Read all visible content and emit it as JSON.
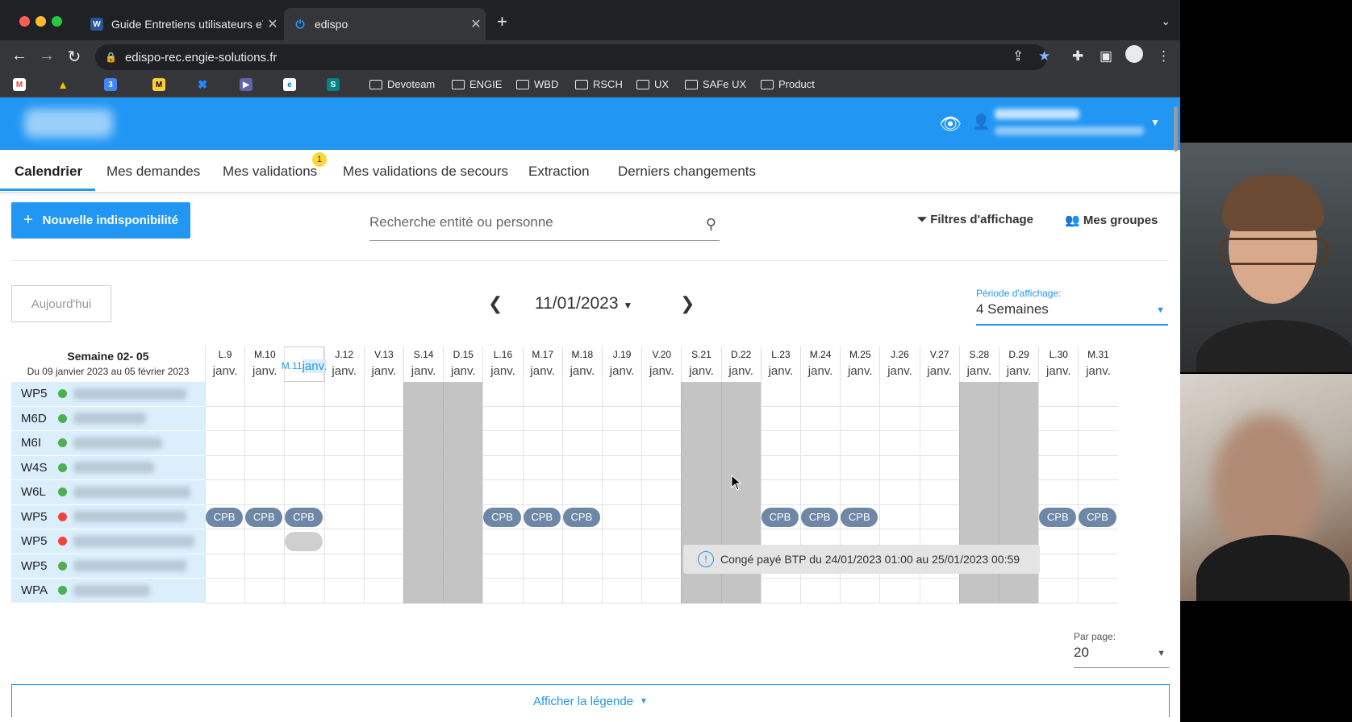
{
  "browser": {
    "tabs": [
      {
        "title": "Guide Entretiens utilisateurs eT",
        "icon": "word-icon",
        "color": "#2b579a"
      },
      {
        "title": "edispo",
        "icon": "power-icon",
        "color": "#2196f3"
      }
    ],
    "url": "edispo-rec.engie-solutions.fr",
    "bookmark_folders": [
      "Devoteam",
      "ENGIE",
      "WBD",
      "RSCH",
      "UX",
      "SAFe UX",
      "Product"
    ]
  },
  "app": {
    "nav": [
      "Calendrier",
      "Mes demandes",
      "Mes validations",
      "Mes validations de secours",
      "Extraction",
      "Derniers changements"
    ],
    "validations_badge": "1",
    "new_button": "Nouvelle indisponibilité",
    "search_placeholder": "Recherche entité ou personne",
    "filters_label": "Filtres d'affichage",
    "groups_label": "Mes groupes",
    "today_button": "Aujourd'hui",
    "current_date": "11/01/2023",
    "period_label": "Période d'affichage:",
    "period_value": "4 Semaines",
    "week_title": "Semaine 02- 05",
    "week_range": "Du 09 janvier 2023 au 05 février 2023",
    "month_label": "janv.",
    "days": [
      "L.9",
      "M.10",
      "M.11",
      "J.12",
      "V.13",
      "S.14",
      "D.15",
      "L.16",
      "M.17",
      "M.18",
      "J.19",
      "V.20",
      "S.21",
      "D.22",
      "L.23",
      "M.24",
      "M.25",
      "J.26",
      "V.27",
      "S.28",
      "D.29",
      "L.30",
      "M.31"
    ],
    "weekend_days": [
      5,
      6,
      12,
      13,
      19,
      20
    ],
    "today_index": 2,
    "rows": [
      {
        "code": "WP5",
        "status_color": "#4caf50"
      },
      {
        "code": "M6D",
        "status_color": "#4caf50"
      },
      {
        "code": "M6I",
        "status_color": "#4caf50"
      },
      {
        "code": "W4S",
        "status_color": "#4caf50"
      },
      {
        "code": "W6L",
        "status_color": "#4caf50"
      },
      {
        "code": "WP5",
        "status_color": "#f44336"
      },
      {
        "code": "WP5",
        "status_color": "#f44336"
      },
      {
        "code": "WP5",
        "status_color": "#4caf50"
      },
      {
        "code": "WPA",
        "status_color": "#4caf50"
      }
    ],
    "absences": [
      {
        "row": 5,
        "days": [
          0,
          1,
          2,
          7,
          8,
          9,
          14,
          15,
          16,
          21,
          22
        ],
        "label": "CPB"
      },
      {
        "row": 6,
        "days": [
          2
        ],
        "label": "",
        "pending": true
      }
    ],
    "tooltip": "Congé payé BTP du 24/01/2023 01:00 au 25/01/2023 00:59",
    "per_page_label": "Par page:",
    "per_page_value": "20",
    "legend_toggle": "Afficher la légende"
  }
}
